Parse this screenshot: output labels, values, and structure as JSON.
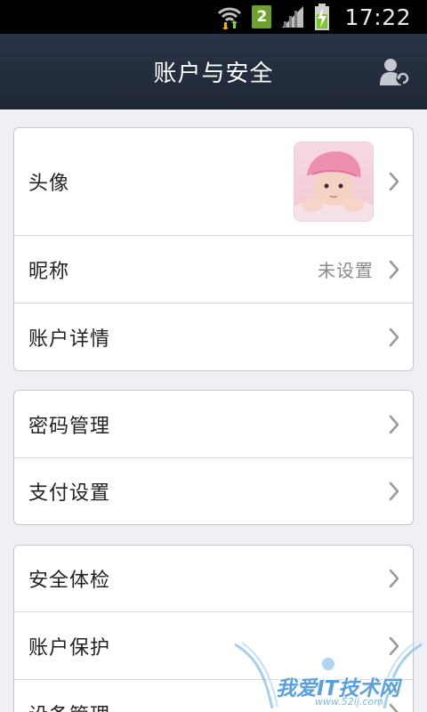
{
  "status_bar": {
    "sim_number": "2",
    "time": "17:22",
    "icons": [
      "wifi-icon",
      "sim-badge",
      "signal-icon",
      "battery-charging-icon"
    ]
  },
  "header": {
    "title": "账户与安全",
    "action_icon": "account-switch-icon"
  },
  "groups": [
    {
      "items": [
        {
          "label": "头像",
          "value": "",
          "has_avatar": true
        },
        {
          "label": "昵称",
          "value": "未设置"
        },
        {
          "label": "账户详情",
          "value": ""
        }
      ]
    },
    {
      "items": [
        {
          "label": "密码管理"
        },
        {
          "label": "支付设置"
        }
      ]
    },
    {
      "items": [
        {
          "label": "安全体检"
        },
        {
          "label": "账户保护"
        },
        {
          "label": "设备管理"
        }
      ]
    }
  ],
  "watermark": {
    "text": "我爱IT技术网",
    "sub": "www.52ij.com"
  },
  "colors": {
    "header_bg": "#232c3d",
    "page_bg": "#efeff4",
    "accent_sim": "#6fa22d"
  }
}
